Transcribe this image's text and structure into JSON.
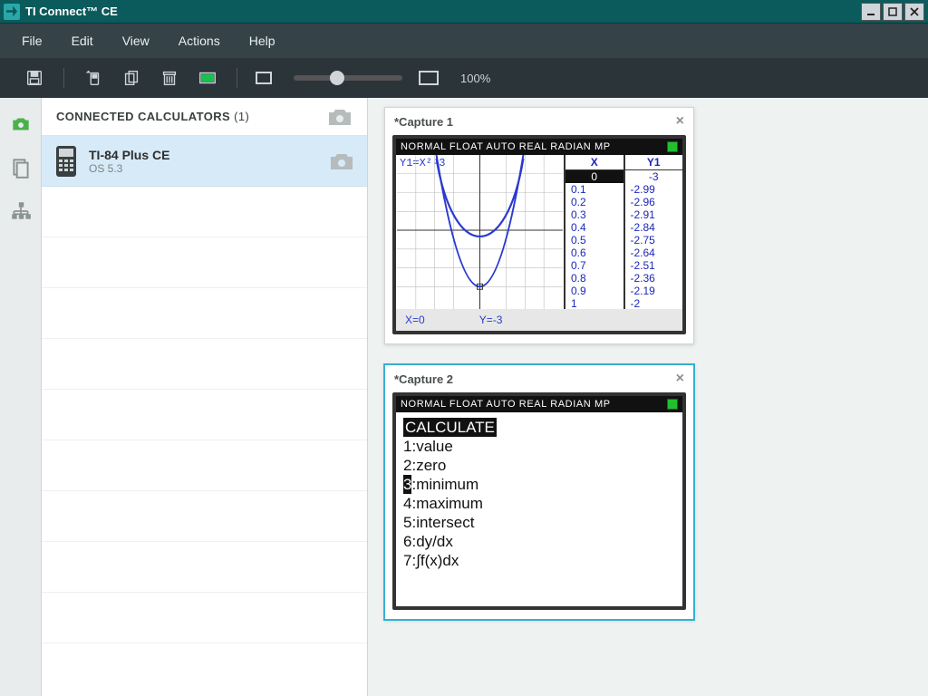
{
  "window": {
    "title": "TI Connect™ CE"
  },
  "menu": {
    "file": "File",
    "edit": "Edit",
    "view": "View",
    "actions": "Actions",
    "help": "Help"
  },
  "toolbar": {
    "zoom_label": "100%"
  },
  "sidebar": {
    "header_label": "CONNECTED CALCULATORS",
    "header_count": "(1)"
  },
  "device": {
    "name": "TI-84 Plus CE",
    "os": "OS 5.3"
  },
  "capture1": {
    "title": "*Capture 1",
    "status": "NORMAL FLOAT AUTO REAL RADIAN MP",
    "equation": "Y1=X²-3",
    "footer_x": "X=0",
    "footer_y": "Y=-3",
    "table": {
      "xhead": "X",
      "yhead": "Y1",
      "rows": [
        {
          "x": "0",
          "y": "-3"
        },
        {
          "x": "0.1",
          "y": "-2.99"
        },
        {
          "x": "0.2",
          "y": "-2.96"
        },
        {
          "x": "0.3",
          "y": "-2.91"
        },
        {
          "x": "0.4",
          "y": "-2.84"
        },
        {
          "x": "0.5",
          "y": "-2.75"
        },
        {
          "x": "0.6",
          "y": "-2.64"
        },
        {
          "x": "0.7",
          "y": "-2.51"
        },
        {
          "x": "0.8",
          "y": "-2.36"
        },
        {
          "x": "0.9",
          "y": "-2.19"
        },
        {
          "x": "1",
          "y": "-2"
        }
      ]
    }
  },
  "capture2": {
    "title": "*Capture 2",
    "status": "NORMAL FLOAT AUTO REAL RADIAN MP",
    "menu_title": "CALCULATE",
    "items": [
      {
        "n": "1",
        "label": "value"
      },
      {
        "n": "2",
        "label": "zero"
      },
      {
        "n": "3",
        "label": "minimum"
      },
      {
        "n": "4",
        "label": "maximum"
      },
      {
        "n": "5",
        "label": "intersect"
      },
      {
        "n": "6",
        "label": "dy/dx"
      },
      {
        "n": "7",
        "label": "∫f(x)dx"
      }
    ],
    "selected_index": 2
  },
  "chart_data": {
    "type": "line",
    "title": "Y1 = X² − 3",
    "xlabel": "X",
    "ylabel": "Y1",
    "xlim": [
      -5,
      5
    ],
    "ylim": [
      -4,
      4
    ],
    "series": [
      {
        "name": "Y1",
        "x": [
          -2.5,
          -2.0,
          -1.5,
          -1.0,
          -0.5,
          0.0,
          0.5,
          1.0,
          1.5,
          2.0,
          2.5
        ],
        "y": [
          3.25,
          1.0,
          -0.75,
          -2.0,
          -2.75,
          -3.0,
          -2.75,
          -2.0,
          -0.75,
          1.0,
          3.25
        ]
      }
    ],
    "table": {
      "x": [
        0,
        0.1,
        0.2,
        0.3,
        0.4,
        0.5,
        0.6,
        0.7,
        0.8,
        0.9,
        1.0
      ],
      "y1": [
        -3,
        -2.99,
        -2.96,
        -2.91,
        -2.84,
        -2.75,
        -2.64,
        -2.51,
        -2.36,
        -2.19,
        -2
      ]
    },
    "cursor": {
      "x": 0,
      "y": -3
    }
  }
}
